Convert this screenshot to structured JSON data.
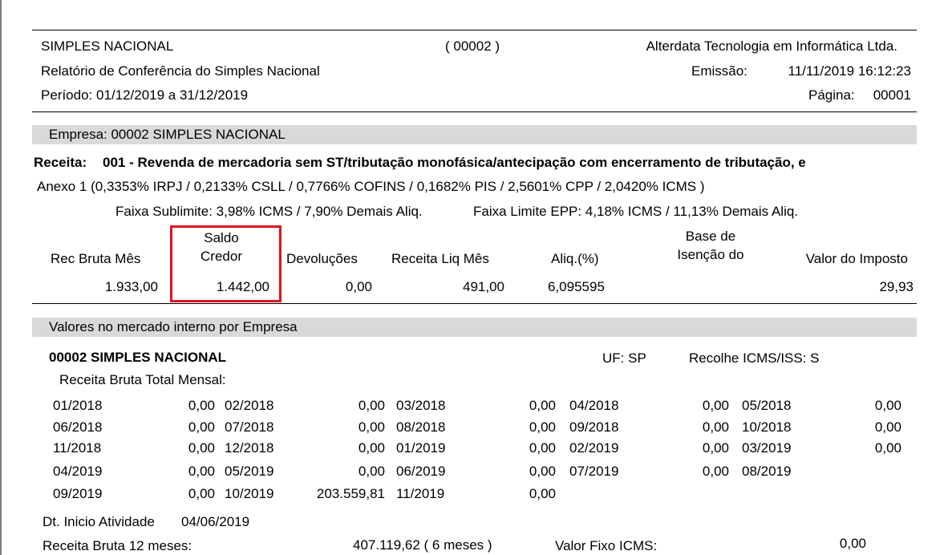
{
  "header": {
    "title": "SIMPLES NACIONAL",
    "code": "( 00002 )",
    "company": "Alterdata Tecnologia em Informática Ltda.",
    "report": "Relatório de Conferência do Simples Nacional",
    "emissao_label": "Emissão:",
    "emissao_value": "11/11/2019 16:12:23",
    "periodo": "Período:  01/12/2019 a 31/12/2019",
    "pagina_label": "Página:",
    "pagina_value": "00001"
  },
  "empresa_band": "Empresa:  00002 SIMPLES NACIONAL",
  "receita": {
    "label": "Receita:",
    "text": "001 - Revenda de mercadoria sem ST/tributação monofásica/antecipação com encerramento de tributação, e",
    "anexo": "Anexo   1  (0,3353% IRPJ  / 0,2133% CSLL / 0,7766% COFINS / 0,1682% PIS  / 2,5601% CPP / 2,0420% ICMS )",
    "faixa_sublimite": "Faixa Sublimite: 3,98% ICMS / 7,90% Demais Aliq.",
    "faixa_limite": "Faixa Limite EPP: 4,18% ICMS / 11,13% Demais Aliq."
  },
  "columns": {
    "rec_bruta_mes": "Rec Bruta Mês",
    "saldo_credor_1": "Saldo",
    "saldo_credor_2": "Credor",
    "devolucoes": "Devoluções",
    "receita_liq_mes": "Receita Liq Mês",
    "aliq": "Aliq.(%)",
    "base_1": "Base de",
    "base_2": "Isenção do",
    "valor_imposto": "Valor do Imposto"
  },
  "values": {
    "rec_bruta_mes": "1.933,00",
    "saldo_credor": "1.442,00",
    "devolucoes": "0,00",
    "receita_liq_mes": "491,00",
    "aliq": "6,095595",
    "valor_imposto": "29,93"
  },
  "mercado_band": "Valores no mercado interno por Empresa",
  "empresa_detail": {
    "name": "00002  SIMPLES NACIONAL",
    "uf": "UF:  SP",
    "recolhe": "Recolhe ICMS/ISS:  S",
    "receita_total_label": "Receita Bruta Total Mensal:"
  },
  "monthly": [
    [
      [
        "01/2018",
        "0,00"
      ],
      [
        "02/2018",
        "0,00"
      ],
      [
        "03/2018",
        "0,00"
      ],
      [
        "04/2018",
        "0,00"
      ],
      [
        "05/2018",
        "0,00"
      ]
    ],
    [
      [
        "06/2018",
        "0,00"
      ],
      [
        "07/2018",
        "0,00"
      ],
      [
        "08/2018",
        "0,00"
      ],
      [
        "09/2018",
        "0,00"
      ],
      [
        "10/2018",
        "0,00"
      ]
    ],
    [
      [
        "11/2018",
        "0,00"
      ],
      [
        "12/2018",
        "0,00"
      ],
      [
        "01/2019",
        "0,00"
      ],
      [
        "02/2019",
        "0,00"
      ],
      [
        "03/2019",
        "0,00"
      ]
    ],
    [
      [
        "04/2019",
        "0,00"
      ],
      [
        "05/2019",
        "0,00"
      ],
      [
        "06/2019",
        "0,00"
      ],
      [
        "07/2019",
        "0,00"
      ],
      [
        "08/2019",
        ""
      ]
    ],
    [
      [
        "09/2019",
        "0,00"
      ],
      [
        "10/2019",
        "203.559,81"
      ],
      [
        "11/2019",
        "0,00"
      ]
    ]
  ],
  "footer": {
    "dt_inicio_label": "Dt. Inicio Atividade",
    "dt_inicio_value": "04/06/2019",
    "receita12_label": "Receita Bruta 12 meses:",
    "receita12_value": "407.119,62  (  6    meses )",
    "valor_fixo_label": "Valor Fixo ICMS:",
    "valor_fixo_value": "0,00"
  }
}
